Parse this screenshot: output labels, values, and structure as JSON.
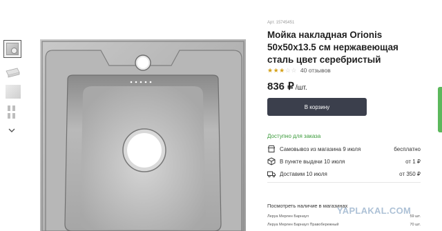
{
  "product": {
    "article": "Арт. 15745451",
    "title": "Мойка накладная Orionis 50x50x13.5 см нержавеющая сталь цвет серебристый",
    "rating": 3.5,
    "reviews": "40 отзывов",
    "price": "836 ₽",
    "price_unit": "/шт.",
    "cart_button": "В корзину"
  },
  "availability": {
    "label": "Доступно для заказа",
    "options": [
      {
        "icon": "store-pickup-icon",
        "label": "Самовывоз из магазина 9 июля",
        "value": "бесплатно"
      },
      {
        "icon": "pickup-point-icon",
        "label": "В пункте выдачи 10 июля",
        "value": "от 1 ₽"
      },
      {
        "icon": "delivery-truck-icon",
        "label": "Доставим 10 июля",
        "value": "от 350 ₽"
      }
    ]
  },
  "stock": {
    "title": "Посмотреть наличие в магазинах",
    "stores": [
      {
        "name": "Леруа Мерлен Барнаул",
        "qty": "59 шт."
      },
      {
        "name": "Леруа Мерлен Барнаул Правобережный",
        "qty": "70 шт."
      }
    ]
  },
  "thumbnails": [
    "sink-photo-thumb",
    "sink-drawing-thumb",
    "sink-closeup-thumb",
    "sink-parts-thumb"
  ],
  "watermark": "YAPLAKAL.COM",
  "colors": {
    "accent_green": "#3a9a3a",
    "button": "#3b3f4c",
    "star": "#d4a017"
  }
}
